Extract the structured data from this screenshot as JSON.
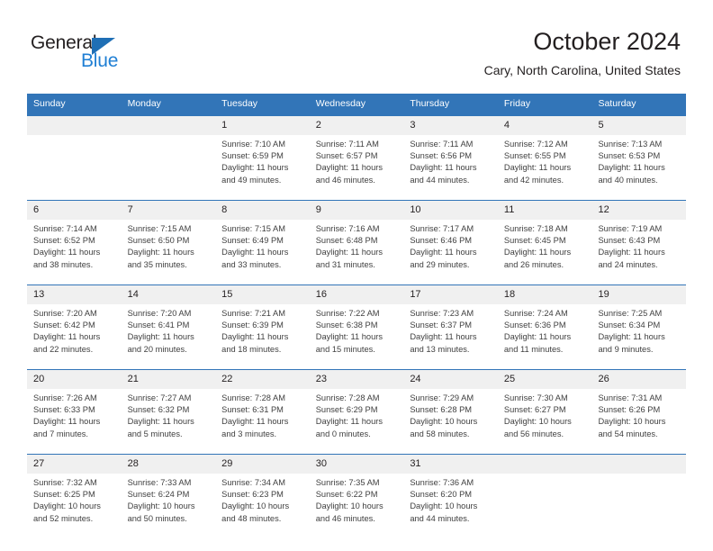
{
  "logo": {
    "word1": "General",
    "word2": "Blue",
    "triangle_color": "#1f6fb5",
    "blue_color": "#1f7fd4"
  },
  "header": {
    "title": "October 2024",
    "subtitle": "Cary, North Carolina, United States"
  },
  "theme": {
    "header_blue": "#3275b8",
    "daynum_bg": "#f0f0f0",
    "text": "#231f20"
  },
  "weekdays": [
    "Sunday",
    "Monday",
    "Tuesday",
    "Wednesday",
    "Thursday",
    "Friday",
    "Saturday"
  ],
  "weeks": [
    {
      "days": [
        {
          "num": "",
          "sunrise": "",
          "sunset": "",
          "daylight": "",
          "daylight2": ""
        },
        {
          "num": "",
          "sunrise": "",
          "sunset": "",
          "daylight": "",
          "daylight2": ""
        },
        {
          "num": "1",
          "sunrise": "Sunrise: 7:10 AM",
          "sunset": "Sunset: 6:59 PM",
          "daylight": "Daylight: 11 hours",
          "daylight2": "and 49 minutes."
        },
        {
          "num": "2",
          "sunrise": "Sunrise: 7:11 AM",
          "sunset": "Sunset: 6:57 PM",
          "daylight": "Daylight: 11 hours",
          "daylight2": "and 46 minutes."
        },
        {
          "num": "3",
          "sunrise": "Sunrise: 7:11 AM",
          "sunset": "Sunset: 6:56 PM",
          "daylight": "Daylight: 11 hours",
          "daylight2": "and 44 minutes."
        },
        {
          "num": "4",
          "sunrise": "Sunrise: 7:12 AM",
          "sunset": "Sunset: 6:55 PM",
          "daylight": "Daylight: 11 hours",
          "daylight2": "and 42 minutes."
        },
        {
          "num": "5",
          "sunrise": "Sunrise: 7:13 AM",
          "sunset": "Sunset: 6:53 PM",
          "daylight": "Daylight: 11 hours",
          "daylight2": "and 40 minutes."
        }
      ]
    },
    {
      "days": [
        {
          "num": "6",
          "sunrise": "Sunrise: 7:14 AM",
          "sunset": "Sunset: 6:52 PM",
          "daylight": "Daylight: 11 hours",
          "daylight2": "and 38 minutes."
        },
        {
          "num": "7",
          "sunrise": "Sunrise: 7:15 AM",
          "sunset": "Sunset: 6:50 PM",
          "daylight": "Daylight: 11 hours",
          "daylight2": "and 35 minutes."
        },
        {
          "num": "8",
          "sunrise": "Sunrise: 7:15 AM",
          "sunset": "Sunset: 6:49 PM",
          "daylight": "Daylight: 11 hours",
          "daylight2": "and 33 minutes."
        },
        {
          "num": "9",
          "sunrise": "Sunrise: 7:16 AM",
          "sunset": "Sunset: 6:48 PM",
          "daylight": "Daylight: 11 hours",
          "daylight2": "and 31 minutes."
        },
        {
          "num": "10",
          "sunrise": "Sunrise: 7:17 AM",
          "sunset": "Sunset: 6:46 PM",
          "daylight": "Daylight: 11 hours",
          "daylight2": "and 29 minutes."
        },
        {
          "num": "11",
          "sunrise": "Sunrise: 7:18 AM",
          "sunset": "Sunset: 6:45 PM",
          "daylight": "Daylight: 11 hours",
          "daylight2": "and 26 minutes."
        },
        {
          "num": "12",
          "sunrise": "Sunrise: 7:19 AM",
          "sunset": "Sunset: 6:43 PM",
          "daylight": "Daylight: 11 hours",
          "daylight2": "and 24 minutes."
        }
      ]
    },
    {
      "days": [
        {
          "num": "13",
          "sunrise": "Sunrise: 7:20 AM",
          "sunset": "Sunset: 6:42 PM",
          "daylight": "Daylight: 11 hours",
          "daylight2": "and 22 minutes."
        },
        {
          "num": "14",
          "sunrise": "Sunrise: 7:20 AM",
          "sunset": "Sunset: 6:41 PM",
          "daylight": "Daylight: 11 hours",
          "daylight2": "and 20 minutes."
        },
        {
          "num": "15",
          "sunrise": "Sunrise: 7:21 AM",
          "sunset": "Sunset: 6:39 PM",
          "daylight": "Daylight: 11 hours",
          "daylight2": "and 18 minutes."
        },
        {
          "num": "16",
          "sunrise": "Sunrise: 7:22 AM",
          "sunset": "Sunset: 6:38 PM",
          "daylight": "Daylight: 11 hours",
          "daylight2": "and 15 minutes."
        },
        {
          "num": "17",
          "sunrise": "Sunrise: 7:23 AM",
          "sunset": "Sunset: 6:37 PM",
          "daylight": "Daylight: 11 hours",
          "daylight2": "and 13 minutes."
        },
        {
          "num": "18",
          "sunrise": "Sunrise: 7:24 AM",
          "sunset": "Sunset: 6:36 PM",
          "daylight": "Daylight: 11 hours",
          "daylight2": "and 11 minutes."
        },
        {
          "num": "19",
          "sunrise": "Sunrise: 7:25 AM",
          "sunset": "Sunset: 6:34 PM",
          "daylight": "Daylight: 11 hours",
          "daylight2": "and 9 minutes."
        }
      ]
    },
    {
      "days": [
        {
          "num": "20",
          "sunrise": "Sunrise: 7:26 AM",
          "sunset": "Sunset: 6:33 PM",
          "daylight": "Daylight: 11 hours",
          "daylight2": "and 7 minutes."
        },
        {
          "num": "21",
          "sunrise": "Sunrise: 7:27 AM",
          "sunset": "Sunset: 6:32 PM",
          "daylight": "Daylight: 11 hours",
          "daylight2": "and 5 minutes."
        },
        {
          "num": "22",
          "sunrise": "Sunrise: 7:28 AM",
          "sunset": "Sunset: 6:31 PM",
          "daylight": "Daylight: 11 hours",
          "daylight2": "and 3 minutes."
        },
        {
          "num": "23",
          "sunrise": "Sunrise: 7:28 AM",
          "sunset": "Sunset: 6:29 PM",
          "daylight": "Daylight: 11 hours",
          "daylight2": "and 0 minutes."
        },
        {
          "num": "24",
          "sunrise": "Sunrise: 7:29 AM",
          "sunset": "Sunset: 6:28 PM",
          "daylight": "Daylight: 10 hours",
          "daylight2": "and 58 minutes."
        },
        {
          "num": "25",
          "sunrise": "Sunrise: 7:30 AM",
          "sunset": "Sunset: 6:27 PM",
          "daylight": "Daylight: 10 hours",
          "daylight2": "and 56 minutes."
        },
        {
          "num": "26",
          "sunrise": "Sunrise: 7:31 AM",
          "sunset": "Sunset: 6:26 PM",
          "daylight": "Daylight: 10 hours",
          "daylight2": "and 54 minutes."
        }
      ]
    },
    {
      "days": [
        {
          "num": "27",
          "sunrise": "Sunrise: 7:32 AM",
          "sunset": "Sunset: 6:25 PM",
          "daylight": "Daylight: 10 hours",
          "daylight2": "and 52 minutes."
        },
        {
          "num": "28",
          "sunrise": "Sunrise: 7:33 AM",
          "sunset": "Sunset: 6:24 PM",
          "daylight": "Daylight: 10 hours",
          "daylight2": "and 50 minutes."
        },
        {
          "num": "29",
          "sunrise": "Sunrise: 7:34 AM",
          "sunset": "Sunset: 6:23 PM",
          "daylight": "Daylight: 10 hours",
          "daylight2": "and 48 minutes."
        },
        {
          "num": "30",
          "sunrise": "Sunrise: 7:35 AM",
          "sunset": "Sunset: 6:22 PM",
          "daylight": "Daylight: 10 hours",
          "daylight2": "and 46 minutes."
        },
        {
          "num": "31",
          "sunrise": "Sunrise: 7:36 AM",
          "sunset": "Sunset: 6:20 PM",
          "daylight": "Daylight: 10 hours",
          "daylight2": "and 44 minutes."
        },
        {
          "num": "",
          "sunrise": "",
          "sunset": "",
          "daylight": "",
          "daylight2": ""
        },
        {
          "num": "",
          "sunrise": "",
          "sunset": "",
          "daylight": "",
          "daylight2": ""
        }
      ]
    }
  ]
}
